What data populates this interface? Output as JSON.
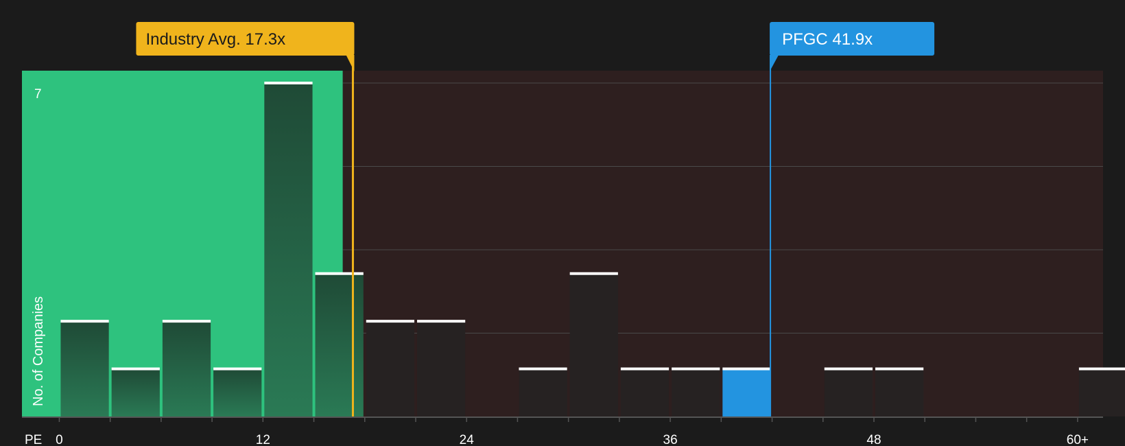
{
  "chart_data": {
    "type": "bar",
    "xlabel": "PE",
    "ylabel": "No. of Companies",
    "x_tick_labels": [
      "0",
      "12",
      "24",
      "36",
      "48",
      "60+"
    ],
    "x_tick_values": [
      0,
      12,
      24,
      36,
      48,
      60
    ],
    "y_tick_label": "7",
    "ylim": [
      0,
      7
    ],
    "xlim": [
      -2.2,
      61.5
    ],
    "bin_width": 3,
    "bins": [
      {
        "start": 0,
        "value": 2
      },
      {
        "start": 3,
        "value": 1
      },
      {
        "start": 6,
        "value": 2
      },
      {
        "start": 9,
        "value": 1
      },
      {
        "start": 12,
        "value": 7
      },
      {
        "start": 15,
        "value": 3
      },
      {
        "start": 18,
        "value": 2
      },
      {
        "start": 21,
        "value": 2
      },
      {
        "start": 27,
        "value": 1
      },
      {
        "start": 30,
        "value": 3
      },
      {
        "start": 33,
        "value": 1
      },
      {
        "start": 36,
        "value": 1
      },
      {
        "start": 39,
        "value": 1,
        "highlight": true
      },
      {
        "start": 45,
        "value": 1
      },
      {
        "start": 48,
        "value": 1
      },
      {
        "start": 60,
        "value": 1
      }
    ],
    "fair_zone_end": 16.7,
    "industry_avg": {
      "label": "Industry Avg. 17.3x",
      "value": 17.3
    },
    "company": {
      "label": "PFGC 41.9x",
      "value": 41.9
    },
    "colors": {
      "background": "#1b1b1b",
      "fair_zone": "#2ec27e",
      "over_zone": "#2e1f1f",
      "bar_over": "#262222",
      "highlight": "#2394e0",
      "industry": "#f0b41c",
      "grid": "#4a4a4a",
      "cap": "#ffffff"
    }
  }
}
